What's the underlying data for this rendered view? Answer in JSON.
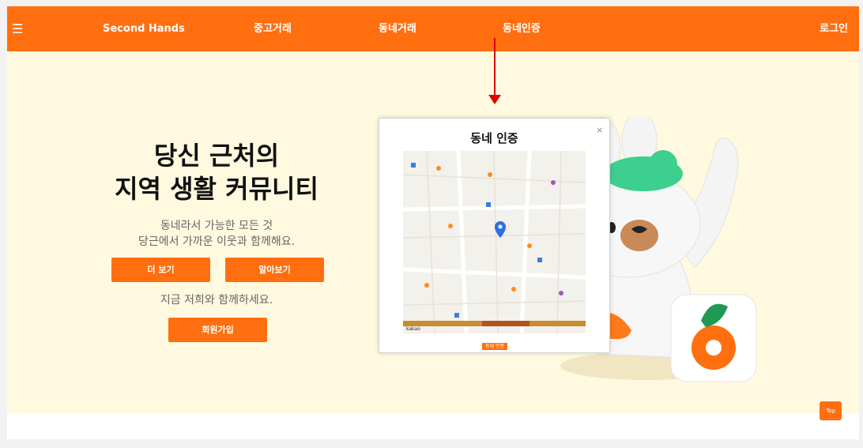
{
  "nav": {
    "menu_icon": "☰",
    "brand": "Second Hands",
    "items": [
      "중고거래",
      "동네거래",
      "동네인증"
    ],
    "login": "로그인"
  },
  "hero": {
    "title_line1": "당신 근처의",
    "title_line2": "지역 생활 커뮤니티",
    "sub_line1": "동네라서 가능한 모든 것",
    "sub_line2": "당근에서 가까운 이웃과 함께해요.",
    "more_button": "더 보기",
    "learn_button": "알아보기",
    "together_text": "지금 저희와 함께하세요.",
    "signup_button": "회원가입"
  },
  "modal": {
    "title": "동네 인증",
    "close": "×",
    "button": "동네 인증",
    "map_credit": "kakao"
  },
  "top_button": "Top",
  "colors": {
    "brand_orange": "#ff6f0f",
    "hero_bg": "#fff9e0",
    "arrow_red": "#e00000",
    "mascot_green": "#3ccf8e"
  }
}
